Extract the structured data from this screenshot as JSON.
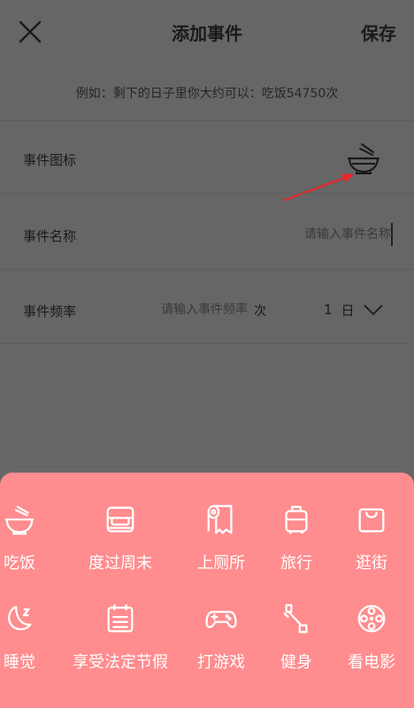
{
  "header": {
    "title": "添加事件",
    "save_label": "保存"
  },
  "hint": "例如：剩下的日子里你大约可以：吃饭54750次",
  "rows": {
    "icon_label": "事件图标",
    "icon_name": "rice-bowl-icon",
    "name_label": "事件名称",
    "name_placeholder": "请输入事件名称",
    "frequency_label": "事件频率",
    "frequency_placeholder": "请输入事件频率",
    "frequency_unit": "次",
    "period_count": "1",
    "period_unit": "日"
  },
  "categories": [
    {
      "label": "吃饭",
      "icon": "rice-bowl-icon"
    },
    {
      "label": "度过周末",
      "icon": "sofa-icon"
    },
    {
      "label": "上厕所",
      "icon": "toilet-paper-icon"
    },
    {
      "label": "旅行",
      "icon": "suitcase-icon"
    },
    {
      "label": "逛街",
      "icon": "shopping-bag-icon"
    },
    {
      "label": "睡觉",
      "icon": "moon-icon"
    },
    {
      "label": "享受法定节假",
      "icon": "calendar-icon"
    },
    {
      "label": "打游戏",
      "icon": "gamepad-icon"
    },
    {
      "label": "健身",
      "icon": "dumbbell-icon"
    },
    {
      "label": "看电影",
      "icon": "film-reel-icon"
    }
  ],
  "colors": {
    "overlay": "#666666",
    "panel": "#ff8c8e",
    "arrow": "#e8262a"
  }
}
